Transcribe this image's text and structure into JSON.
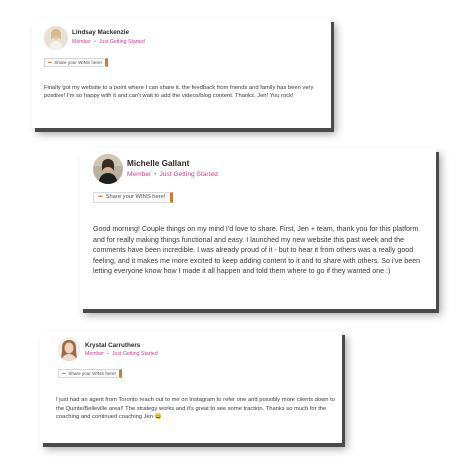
{
  "posts": [
    {
      "author": "Lindsay Mackenzie",
      "role": "Member",
      "level": "Just Getting Started",
      "tag_dots": "•••",
      "tag": "Share your WINS here!",
      "body": "Finally got my website to a point where I can share it, the feedback from friends and family has been very positive! I'm so happy with it and can't wait to add the videos/blog content. Thanks, Jen! You rock!"
    },
    {
      "author": "Michelle Gallant",
      "role": "Member",
      "level": "Just Getting Started",
      "tag_dots": "•••",
      "tag": "Share your WINS here!",
      "body": "Good morning! Couple things on my mind I'd love to share. First, Jen + team, thank you for this platform and for really making things functional and easy. I launched my new website this past week and the comments have been incredible. I was already proud of it - but to hear it from others was a really good feeling, and it makes me more excited to keep adding content to it and to share with others. So i've been letting everyone know how I made it all happen and told them where to go if they wanted one :)"
    },
    {
      "author": "Krystal Carruthers",
      "role": "Member",
      "level": "Just Getting Started",
      "tag_dots": "•••",
      "tag": "Share your WINS here!",
      "body": "I just had an agent from Toronto reach out to me on Instagram to refer one and possibly more clients down to the Quinte/Belleville area!! The strategy works and it's great to see some traction.  Thanks so much for the coaching and continued coaching Jen 😀"
    }
  ],
  "colors": {
    "accent": "#d13a8f",
    "tag_border": "#d07a34"
  }
}
